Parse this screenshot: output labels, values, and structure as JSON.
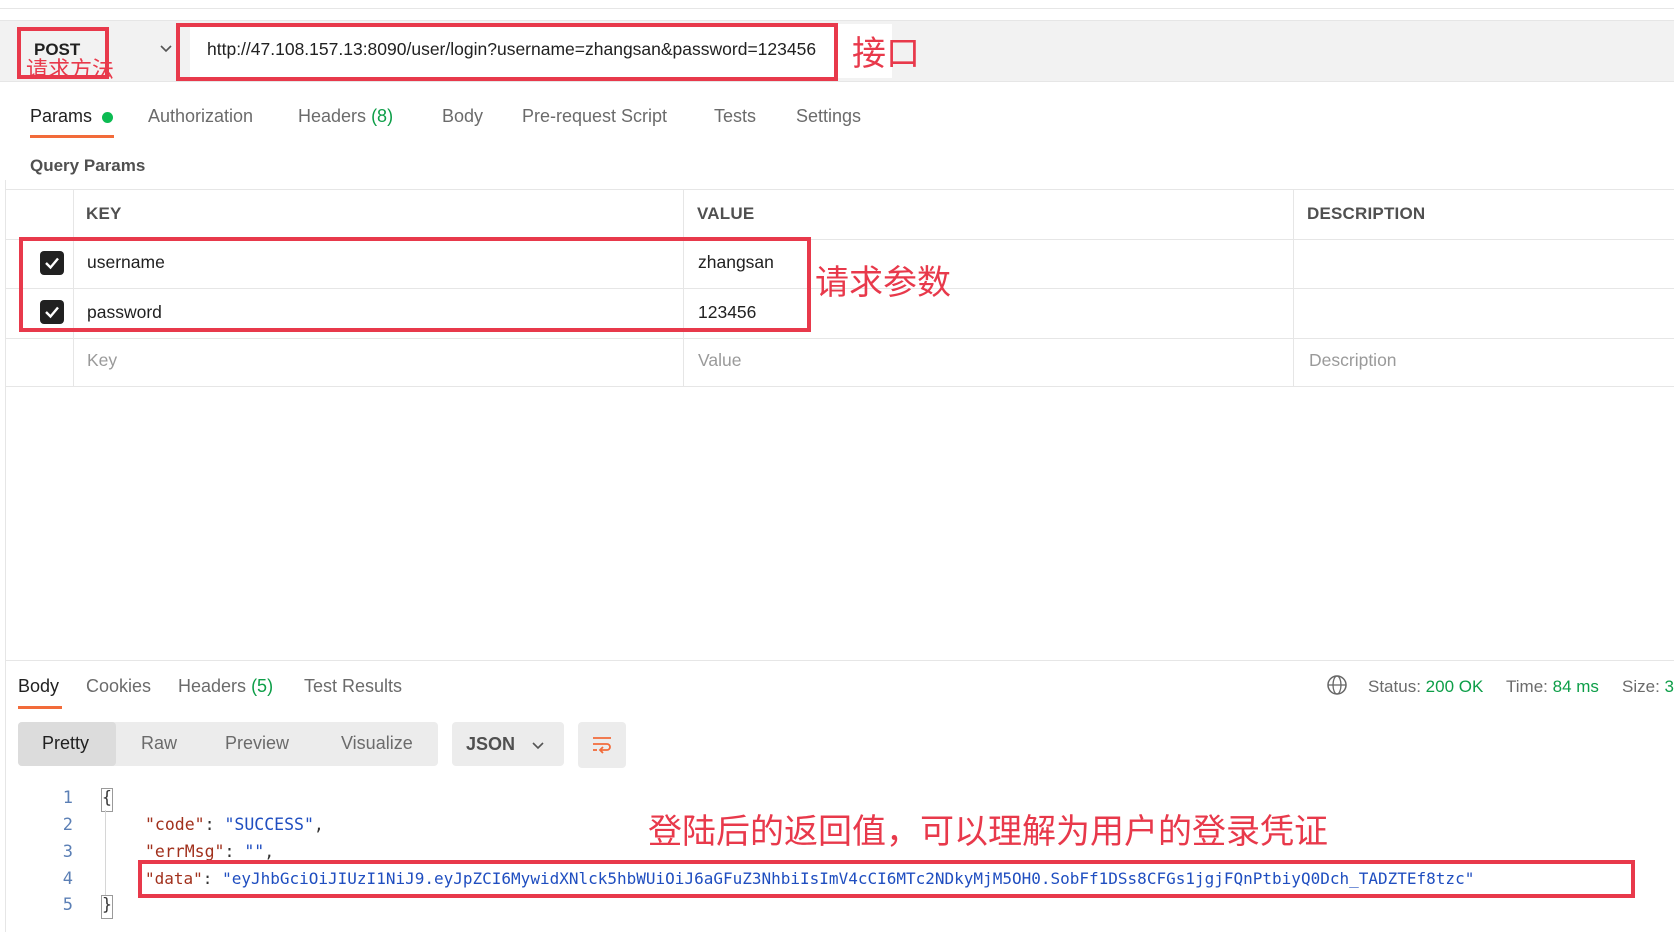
{
  "request": {
    "method": "POST",
    "url": "http://47.108.157.13:8090/user/login?username=zhangsan&password=123456"
  },
  "annotations": {
    "method": "请求方法",
    "endpoint": "接口",
    "params": "请求参数",
    "response": "登陆后的返回值，可以理解为用户的登录凭证"
  },
  "request_tabs": [
    {
      "label": "Params",
      "active": true,
      "dot": "green"
    },
    {
      "label": "Authorization"
    },
    {
      "label": "Headers",
      "count": "(8)"
    },
    {
      "label": "Body"
    },
    {
      "label": "Pre-request Script"
    },
    {
      "label": "Tests"
    },
    {
      "label": "Settings"
    }
  ],
  "query_params": {
    "title": "Query Params",
    "columns": [
      "KEY",
      "VALUE",
      "DESCRIPTION"
    ],
    "rows": [
      {
        "checked": true,
        "key": "username",
        "value": "zhangsan",
        "description": ""
      },
      {
        "checked": true,
        "key": "password",
        "value": "123456",
        "description": ""
      }
    ],
    "placeholders": {
      "key": "Key",
      "value": "Value",
      "description": "Description"
    }
  },
  "response_tabs": [
    {
      "label": "Body",
      "active": true
    },
    {
      "label": "Cookies"
    },
    {
      "label": "Headers",
      "count": "(5)"
    },
    {
      "label": "Test Results"
    }
  ],
  "status": {
    "status_label": "Status:",
    "status_value": "200 OK",
    "time_label": "Time:",
    "time_value": "84 ms",
    "size_label": "Size:",
    "size_value": "3"
  },
  "view_modes": [
    "Pretty",
    "Raw",
    "Preview",
    "Visualize"
  ],
  "active_view": "Pretty",
  "format": "JSON",
  "code_lines": {
    "line_numbers": [
      "1",
      "2",
      "3",
      "4",
      "5"
    ],
    "open_brace": "{",
    "close_brace": "}",
    "code_key": "\"code\"",
    "code_value": "\"SUCCESS\"",
    "errmsg_key": "\"errMsg\"",
    "errmsg_value": "\"\"",
    "data_key": "\"data\"",
    "data_value": "\"eyJhbGciOiJIUzI1NiJ9.eyJpZCI6MywidXNlck5hbWUiOiJ6aGFuZ3NhbiIsImV4cCI6MTc2NDkyMjM5OH0.SobFf1DSs8CFGs1jgjFQnPtbiyQ0Dch_TADZTEf8tzc\""
  },
  "colors": {
    "annotation_red": "#e8394b",
    "active_tab_orange": "#f26b3a",
    "status_green": "#0d9e48"
  }
}
